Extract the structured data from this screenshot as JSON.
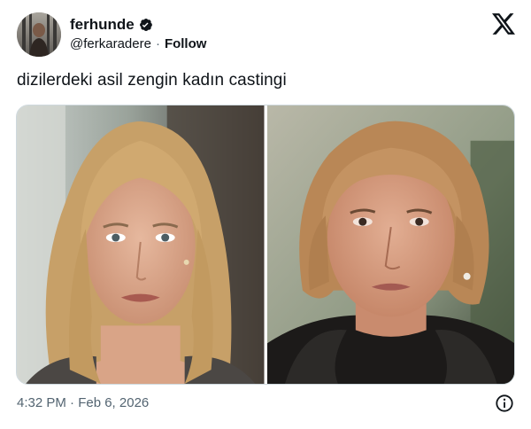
{
  "author": {
    "display_name": "ferhunde",
    "handle": "@ferkaradere",
    "separator": "·",
    "follow_label": "Follow",
    "verified": true
  },
  "tweet": {
    "text": "dizilerdeki asil zengin kadın castingi"
  },
  "media": {
    "photos": [
      {
        "icon": "photo-blonde-woman"
      },
      {
        "icon": "photo-older-woman"
      }
    ]
  },
  "footer": {
    "timestamp": "4:32 PM · Feb 6, 2026",
    "info_icon": "info-icon"
  },
  "colors": {
    "text_primary": "#0f1419",
    "text_secondary": "#536471",
    "border": "#cfd9de",
    "background": "#ffffff"
  }
}
